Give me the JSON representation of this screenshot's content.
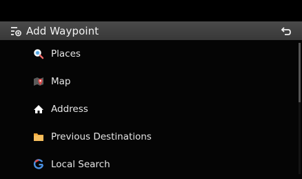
{
  "header": {
    "title": "Add Waypoint",
    "title_icon": "route-waypoint-icon",
    "back_icon": "back-arrow-icon"
  },
  "menu": {
    "items": [
      {
        "label": "Places",
        "icon": "search-magnifier-icon",
        "color": "#4fa3e0"
      },
      {
        "label": "Map",
        "icon": "map-pin-icon",
        "color": "#e04a4a"
      },
      {
        "label": "Address",
        "icon": "home-icon",
        "color": "#ffffff"
      },
      {
        "label": "Previous Destinations",
        "icon": "folder-icon",
        "color": "#f2a93b"
      },
      {
        "label": "Local Search",
        "icon": "google-g-icon",
        "color": "#4a90e2"
      }
    ]
  },
  "colors": {
    "title_bar": "#404040",
    "background": "#050505",
    "text": "#e6e6e6"
  }
}
